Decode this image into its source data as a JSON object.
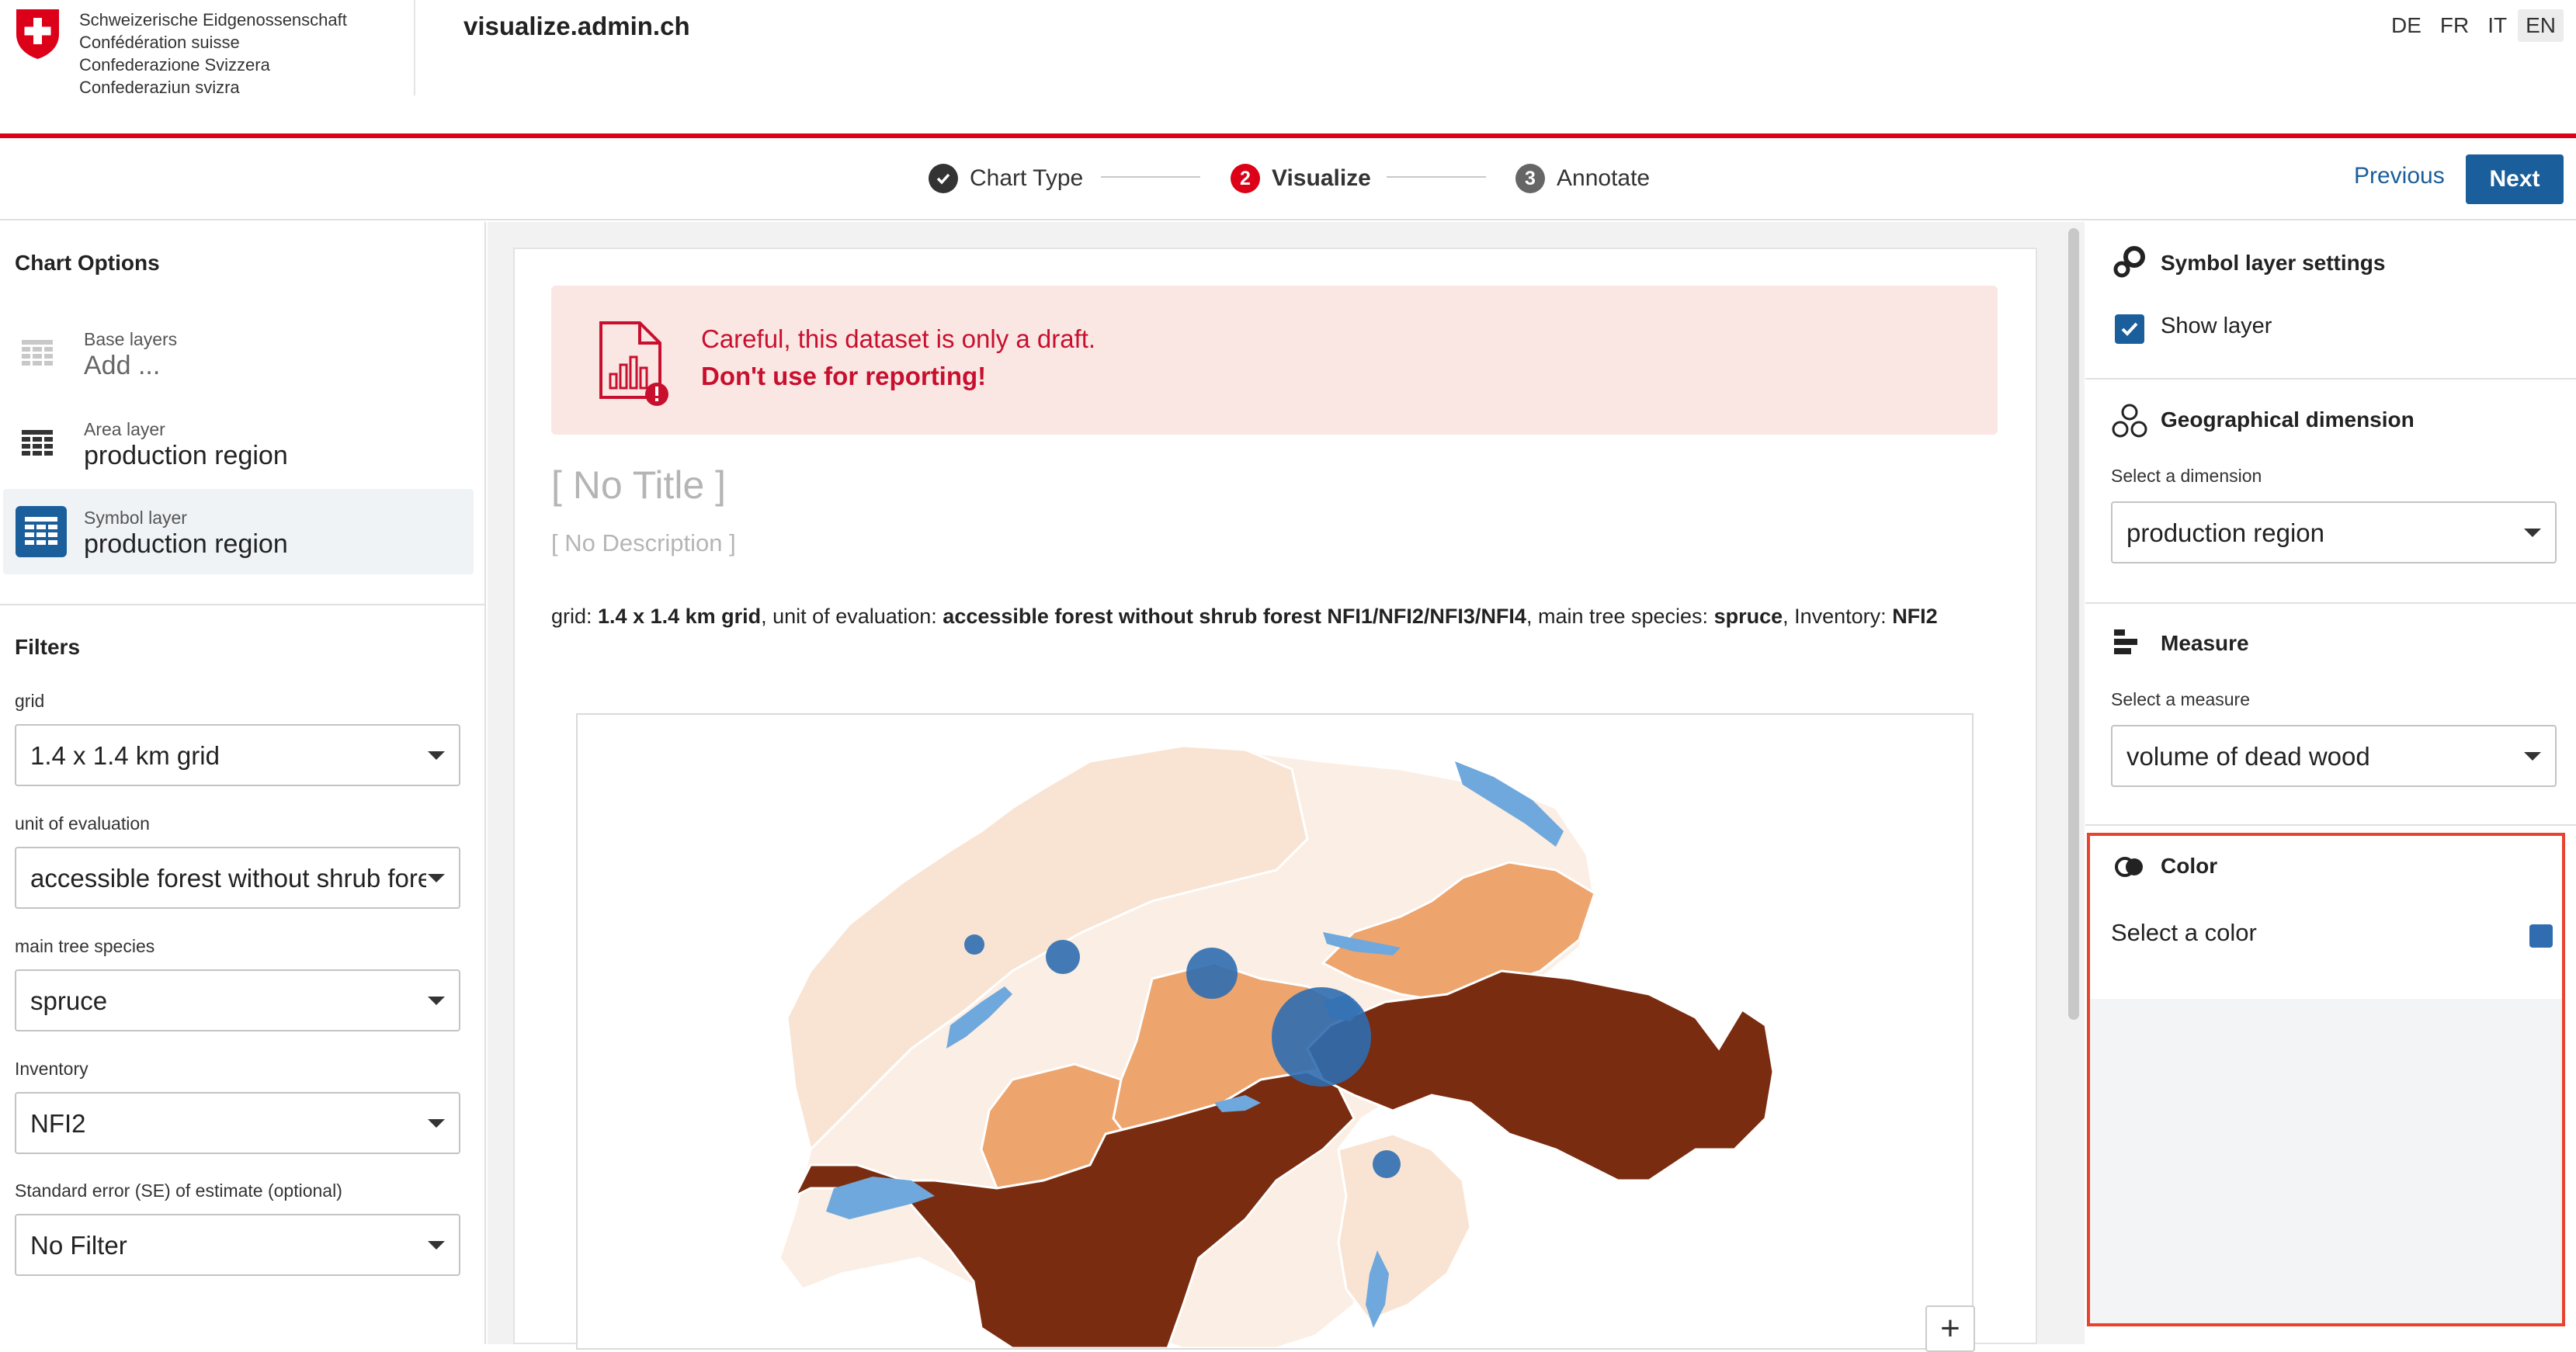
{
  "header": {
    "org_names": [
      "Schweizerische Eidgenossenschaft",
      "Confédération suisse",
      "Confederazione Svizzera",
      "Confederaziun svizra"
    ],
    "site_title": "visualize.admin.ch",
    "languages": [
      "DE",
      "FR",
      "IT",
      "EN"
    ],
    "active_language": "EN",
    "brand_red": "#dc0018"
  },
  "stepper": {
    "steps": [
      {
        "label": "Chart Type",
        "badge": "✓",
        "state": "done"
      },
      {
        "label": "Visualize",
        "badge": "2",
        "state": "active"
      },
      {
        "label": "Annotate",
        "badge": "3",
        "state": "todo"
      }
    ],
    "previous_label": "Previous",
    "next_label": "Next",
    "accent": "#1a5e9b"
  },
  "chart_options": {
    "title": "Chart Options",
    "layers": [
      {
        "kind": "Base layers",
        "value": "Add ...",
        "selected": false,
        "icon": "grid-table-icon"
      },
      {
        "kind": "Area layer",
        "value": "production region",
        "selected": false,
        "icon": "table-icon"
      },
      {
        "kind": "Symbol layer",
        "value": "production region",
        "selected": true,
        "icon": "table-icon"
      }
    ]
  },
  "filters": {
    "title": "Filters",
    "items": [
      {
        "label": "grid",
        "value": "1.4 x 1.4 km grid"
      },
      {
        "label": "unit of evaluation",
        "value": "accessible forest without shrub forest NFI1/NFI2/NFI3/NFI4"
      },
      {
        "label": "main tree species",
        "value": "spruce"
      },
      {
        "label": "Inventory",
        "value": "NFI2"
      },
      {
        "label": "Standard error (SE) of estimate (optional)",
        "value": "No Filter"
      }
    ]
  },
  "main": {
    "alert_line1": "Careful, this dataset is only a draft.",
    "alert_line2": "Don't use for reporting!",
    "title_placeholder": "[ No Title ]",
    "description_placeholder": "[ No Description ]",
    "filter_summary": [
      {
        "text": "grid: ",
        "bold": false
      },
      {
        "text": "1.4 x 1.4 km grid",
        "bold": true
      },
      {
        "text": ", unit of evaluation: ",
        "bold": false
      },
      {
        "text": "accessible forest without shrub forest NFI1/NFI2/NFI3/NFI4",
        "bold": true
      },
      {
        "text": ", main tree species: ",
        "bold": false
      },
      {
        "text": "spruce",
        "bold": true
      },
      {
        "text": ", Inventory: ",
        "bold": false
      },
      {
        "text": "NFI2",
        "bold": true
      }
    ],
    "zoom_in_label": "+",
    "map_colors": {
      "lightest": "#fbeee4",
      "light": "#f9e4d3",
      "medium": "#eea46d",
      "dark": "#7a2c10",
      "lakes": "#6fa8dc",
      "symbols": "#2f6db0"
    }
  },
  "right_panel": {
    "symbol_settings_title": "Symbol layer settings",
    "show_layer_label": "Show layer",
    "show_layer_checked": true,
    "geo_title": "Geographical dimension",
    "geo_select_label": "Select a dimension",
    "geo_value": "production region",
    "measure_title": "Measure",
    "measure_select_label": "Select a measure",
    "measure_value": "volume of dead wood",
    "color_title": "Color",
    "color_select_label": "Select a color",
    "color_value": "#2f6db0",
    "highlight_color": "#e8432d"
  }
}
